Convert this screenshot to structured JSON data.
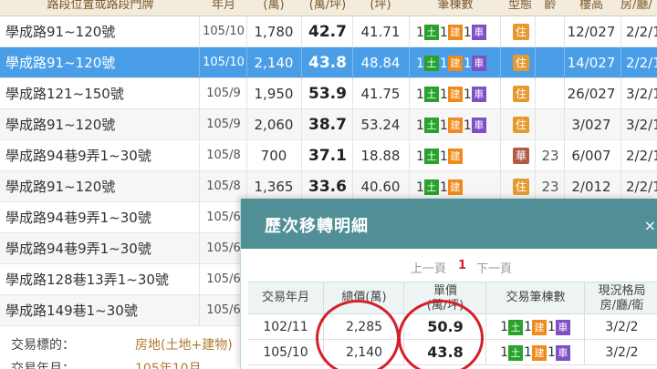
{
  "header": {
    "address": "路段位置或路段門牌",
    "year_month": "年月",
    "total": "(萬)",
    "unit": "(萬/坪)",
    "area": "(坪)",
    "count": "筆棟數",
    "type": "型態",
    "age": "齡",
    "floor": "樓高",
    "layout": "房/廳/"
  },
  "count_labels": {
    "land": "土",
    "building": "建",
    "car": "車"
  },
  "rows": [
    {
      "address": "學成路91~120號",
      "ym": "105/10",
      "total": "1,780",
      "unit": "42.7",
      "area": "41.71",
      "land": "1",
      "building": "1",
      "car": "1",
      "type": "住",
      "age": "",
      "floor": "12/027",
      "layout": "2/2/1"
    },
    {
      "address": "學成路91~120號",
      "ym": "105/10",
      "total": "2,140",
      "unit": "43.8",
      "area": "48.84",
      "land": "1",
      "building": "1",
      "car": "1",
      "type": "住",
      "age": "",
      "floor": "14/027",
      "layout": "2/2/1"
    },
    {
      "address": "學成路121~150號",
      "ym": "105/9",
      "total": "1,950",
      "unit": "53.9",
      "area": "41.75",
      "land": "1",
      "building": "1",
      "car": "1",
      "type": "住",
      "age": "",
      "floor": "26/027",
      "layout": "3/2/1"
    },
    {
      "address": "學成路91~120號",
      "ym": "105/9",
      "total": "2,060",
      "unit": "38.7",
      "area": "53.24",
      "land": "1",
      "building": "1",
      "car": "1",
      "type": "住",
      "age": "",
      "floor": "3/027",
      "layout": "3/2/1"
    },
    {
      "address": "學成路94巷9弄1~30號",
      "ym": "105/8",
      "total": "700",
      "unit": "37.1",
      "area": "18.88",
      "land": "1",
      "building": "1",
      "car": "",
      "type": "華",
      "age": "23",
      "floor": "6/007",
      "layout": "2/2/1"
    },
    {
      "address": "學成路91~120號",
      "ym": "105/8",
      "total": "1,365",
      "unit": "33.6",
      "area": "40.60",
      "land": "1",
      "building": "1",
      "car": "",
      "type": "住",
      "age": "23",
      "floor": "2/012",
      "layout": "2/2/1"
    },
    {
      "address": "學成路94巷9弄1~30號",
      "ym": "105/6",
      "total": "",
      "unit": "",
      "area": "",
      "land": "",
      "building": "",
      "car": "",
      "type": "",
      "age": "",
      "floor": "",
      "layout": ""
    },
    {
      "address": "學成路94巷9弄1~30號",
      "ym": "105/6",
      "total": "",
      "unit": "",
      "area": "",
      "land": "",
      "building": "",
      "car": "",
      "type": "",
      "age": "",
      "floor": "",
      "layout": ""
    },
    {
      "address": "學成路128巷13弄1~30號",
      "ym": "105/6",
      "total": "",
      "unit": "",
      "area": "",
      "land": "",
      "building": "",
      "car": "",
      "type": "",
      "age": "",
      "floor": "",
      "layout": ""
    },
    {
      "address": "學成路149巷1~30號",
      "ym": "105/6",
      "total": "",
      "unit": "",
      "area": "",
      "land": "",
      "building": "",
      "car": "",
      "type": "",
      "age": "",
      "floor": "",
      "layout": ""
    }
  ],
  "details": {
    "target_label": "交易標的：",
    "target_value": "房地(土地+建物)",
    "date_label": "交易年月：",
    "date_value": "105年10月"
  },
  "popup": {
    "title": "歷次移轉明細",
    "close": "×",
    "prev": "上一頁",
    "page": "1",
    "next": "下一頁",
    "headers": {
      "ym": "交易年月",
      "total": "總價(萬)",
      "unit_top": "單價",
      "unit_bottom": "(萬/坪)",
      "count": "交易筆棟數",
      "layout_top": "現況格局",
      "layout_bottom": "房/廳/衛"
    },
    "rows": [
      {
        "ym": "102/11",
        "total": "2,285",
        "unit": "50.9",
        "land": "1",
        "building": "1",
        "car": "1",
        "layout": "3/2/2"
      },
      {
        "ym": "105/10",
        "total": "2,140",
        "unit": "43.8",
        "land": "1",
        "building": "1",
        "car": "1",
        "layout": "3/2/2"
      }
    ]
  },
  "colors": {
    "header_bg": "#f3ebdc",
    "selected_row": "#4a9ee8",
    "popup_title": "#4f8f95",
    "land": "#27a22b",
    "building": "#ef8a1c",
    "car": "#7f4fc6",
    "badge": "#e59a2f",
    "highlight_circle": "#d3202a"
  }
}
